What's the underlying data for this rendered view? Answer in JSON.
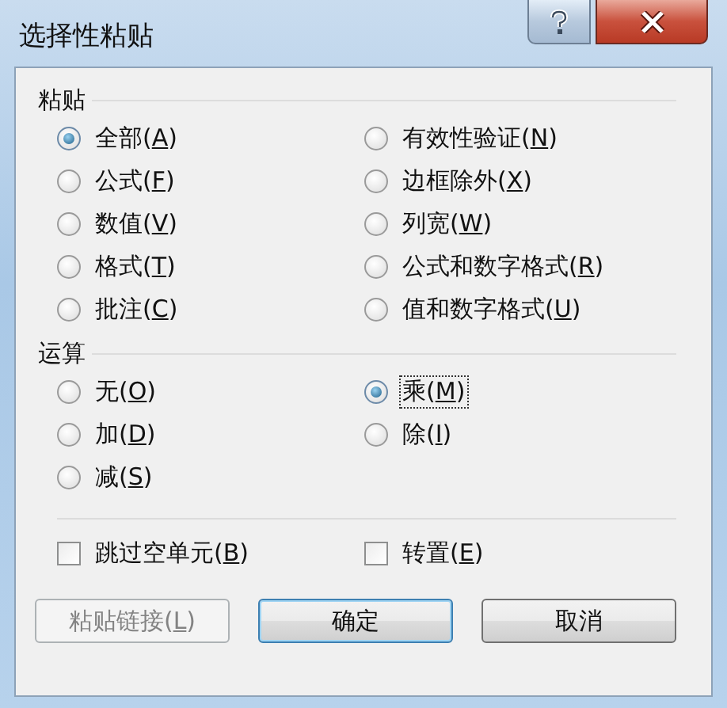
{
  "window": {
    "title": "选择性粘贴"
  },
  "groups": [
    {
      "title": "粘贴",
      "options": [
        {
          "label": "全部(A)",
          "selected": true,
          "focused": false
        },
        {
          "label": "有效性验证(N)",
          "selected": false,
          "focused": false
        },
        {
          "label": "公式(F)",
          "selected": false,
          "focused": false
        },
        {
          "label": "边框除外(X)",
          "selected": false,
          "focused": false
        },
        {
          "label": "数值(V)",
          "selected": false,
          "focused": false
        },
        {
          "label": "列宽(W)",
          "selected": false,
          "focused": false
        },
        {
          "label": "格式(T)",
          "selected": false,
          "focused": false
        },
        {
          "label": "公式和数字格式(R)",
          "selected": false,
          "focused": false
        },
        {
          "label": "批注(C)",
          "selected": false,
          "focused": false
        },
        {
          "label": "值和数字格式(U)",
          "selected": false,
          "focused": false
        }
      ]
    },
    {
      "title": "运算",
      "options": [
        {
          "label": "无(O)",
          "selected": false,
          "focused": false
        },
        {
          "label": "乘(M)",
          "selected": true,
          "focused": true
        },
        {
          "label": "加(D)",
          "selected": false,
          "focused": false
        },
        {
          "label": "除(I)",
          "selected": false,
          "focused": false
        },
        {
          "label": "减(S)",
          "selected": false,
          "focused": false
        }
      ]
    }
  ],
  "checkboxes": [
    {
      "label": "跳过空单元(B)",
      "checked": false
    },
    {
      "label": "转置(E)",
      "checked": false
    }
  ],
  "buttons": [
    {
      "label": "粘贴链接(L)",
      "disabled": true,
      "default": false
    },
    {
      "label": "确定",
      "disabled": false,
      "default": true
    },
    {
      "label": "取消",
      "disabled": false,
      "default": false
    }
  ]
}
